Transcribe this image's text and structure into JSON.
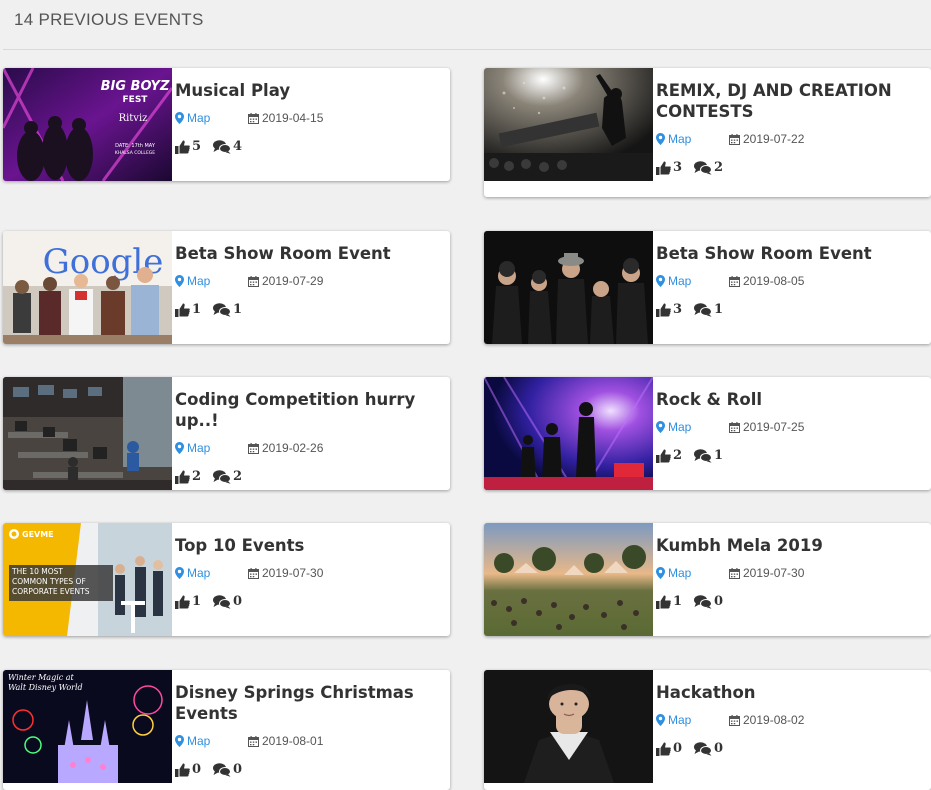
{
  "header": {
    "title": "14  PREVIOUS EVENTS"
  },
  "labels": {
    "map": "Map"
  },
  "events": [
    {
      "title": "Musical Play",
      "date": "2019-04-15",
      "likes": "5",
      "comments": "4"
    },
    {
      "title": "REMIX, DJ AND CREATION CONTESTS",
      "date": "2019-07-22",
      "likes": "3",
      "comments": "2"
    },
    {
      "title": "Beta Show Room Event",
      "date": "2019-07-29",
      "likes": "1",
      "comments": "1"
    },
    {
      "title": "Beta Show Room Event",
      "date": "2019-08-05",
      "likes": "3",
      "comments": "1"
    },
    {
      "title": "Coding Competition hurry up..!",
      "date": "2019-02-26",
      "likes": "2",
      "comments": "2"
    },
    {
      "title": "Rock & Roll",
      "date": "2019-07-25",
      "likes": "2",
      "comments": "1"
    },
    {
      "title": "Top 10 Events",
      "date": "2019-07-30",
      "likes": "1",
      "comments": "0"
    },
    {
      "title": "Kumbh Mela 2019",
      "date": "2019-07-30",
      "likes": "1",
      "comments": "0"
    },
    {
      "title": "Disney Springs Christmas Events",
      "date": "2019-08-01",
      "likes": "0",
      "comments": "0"
    },
    {
      "title": "Hackathon",
      "date": "2019-08-02",
      "likes": "0",
      "comments": "0"
    }
  ],
  "thumb_text": {
    "bigboyz_title": "BIG BOYZ",
    "bigboyz_sub": "FEST",
    "bigboyz_ritviz": "Ritviz",
    "bigboyz_date": "DATE: 17th MAY",
    "bigboyz_venue": "KHALSA COLLEGE",
    "google": "Google",
    "gevme_brand": "GEVME",
    "gevme_line1": "THE 10 MOST",
    "gevme_line2": "COMMON TYPES OF",
    "gevme_line3": "CORPORATE EVENTS",
    "disney_line1": "Winter Magic at",
    "disney_line2": "Walt Disney World"
  },
  "colors": {
    "link": "#2f8fe0",
    "title": "#333333",
    "background": "#f0f0f0",
    "card": "#ffffff"
  }
}
